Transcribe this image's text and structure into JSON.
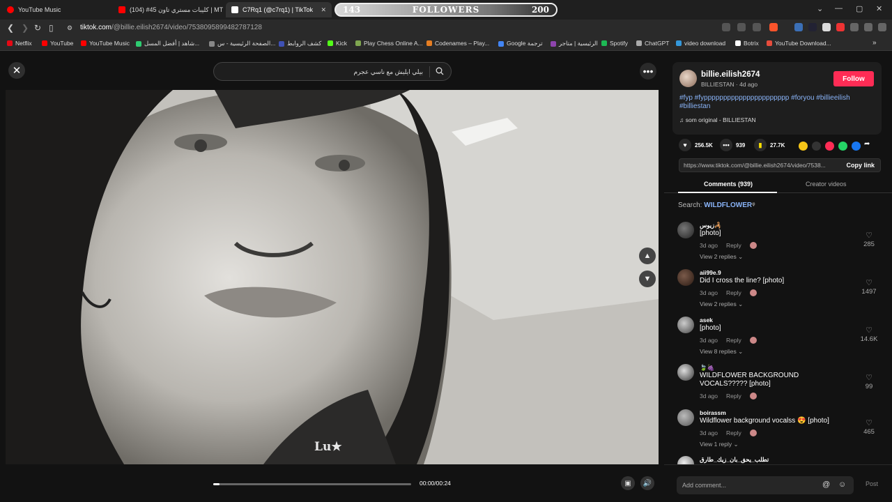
{
  "browser": {
    "tabs": [
      {
        "title": "YouTube Music",
        "color": "#ff0000"
      },
      {
        "title": "(104) #45 كليبات مستري تاون | MT",
        "color": "#ff0000"
      },
      {
        "title": "C7Rq1 (@c7rq1) | TikTok",
        "color": "#ffffff"
      }
    ],
    "tab_close": "✕",
    "url_domain": "tiktok.com",
    "url_path": "/@billie.eilish2674/video/7538095899482787128",
    "window_controls": [
      "⌄",
      "—",
      "▢",
      "✕"
    ]
  },
  "overlay": {
    "followers_current": "143",
    "followers_label": "FOLLOWERS",
    "followers_goal": "200",
    "followers_progress": 0.715
  },
  "bookmarks": [
    {
      "label": "Netflix",
      "color": "#e50914"
    },
    {
      "label": "YouTube",
      "color": "#ff0000"
    },
    {
      "label": "YouTube Music",
      "color": "#ff0000"
    },
    {
      "label": "شاهد | أفضل المسل...",
      "color": "#2ecc71"
    },
    {
      "label": "الصفحة الرئيسية - س...",
      "color": "#888888"
    },
    {
      "label": "كشف الروابط",
      "color": "#3f51b5"
    },
    {
      "label": "Kick",
      "color": "#53fc18"
    },
    {
      "label": "Play Chess Online A...",
      "color": "#7fa650"
    },
    {
      "label": "Codenames – Play...",
      "color": "#e67e22"
    },
    {
      "label": "Google ترجمة",
      "color": "#4285f4"
    },
    {
      "label": "الرئيسية | متاجر",
      "color": "#8e44ad"
    },
    {
      "label": "Spotify",
      "color": "#1db954"
    },
    {
      "label": "ChatGPT",
      "color": "#aaaaaa"
    },
    {
      "label": "video download",
      "color": "#3498db"
    },
    {
      "label": "Botrix",
      "color": "#ffffff"
    },
    {
      "label": "YouTube Download...",
      "color": "#e74c3c"
    }
  ],
  "viewer": {
    "search_text": "بيلي ايليش مع ناسي عجرم",
    "watermark": "Lu★",
    "time": "00:00/00:24",
    "progress": 0.03
  },
  "creator": {
    "username": "billie.eilish2674",
    "subline": "BILLIESTAN · 4d ago",
    "follow_label": "Follow",
    "hashtags": "#fyp #fypppppppppppppppppppppp #foryou #billieeilish #billiestan",
    "music": "♫ som original - BILLIESTAN"
  },
  "stats": {
    "likes": "256.5K",
    "comments": "939",
    "saves": "27.7K"
  },
  "share": {
    "link": "https://www.tiktok.com/@billie.eilish2674/video/7538...",
    "copy_label": "Copy link"
  },
  "panel_tabs": {
    "comments": "Comments (939)",
    "creator_videos": "Creator videos"
  },
  "search_suggest": {
    "prefix": "Search: ",
    "keyword": "WILDFLOWER",
    "suffix": "ᵠ"
  },
  "comments": [
    {
      "user": "زيوس🦂",
      "text": "[photo]",
      "date": "3d ago",
      "reply": "Reply",
      "replies": "View 2 replies ⌄",
      "likes": "285"
    },
    {
      "user": "aii99e.9",
      "text": "Did I cross the line? [photo]",
      "date": "3d ago",
      "reply": "Reply",
      "replies": "View 2 replies ⌄",
      "likes": "1497"
    },
    {
      "user": "asek",
      "text": "[photo]",
      "date": "3d ago",
      "reply": "Reply",
      "replies": "View 8 replies ⌄",
      "likes": "14.6K"
    },
    {
      "user": "🍃🍇",
      "text": "WILDFLOWER BACKGROUND VOCALS????? [photo]",
      "date": "3d ago",
      "reply": "Reply",
      "replies": "",
      "likes": "99"
    },
    {
      "user": "boirassm",
      "text": "Wildflower background vocalss 😍 [photo]",
      "date": "3d ago",
      "reply": "Reply",
      "replies": "View 1 reply ⌄",
      "likes": "465"
    },
    {
      "user": "تطلب_يحق_بان_زيك_طارق",
      "text": "",
      "date": "",
      "reply": "",
      "replies": "",
      "likes": ""
    }
  ],
  "comment_bar": {
    "placeholder": "Add comment...",
    "post_label": "Post"
  },
  "colors": {
    "accent": "#fe2c55",
    "link": "#8ab4f8"
  }
}
